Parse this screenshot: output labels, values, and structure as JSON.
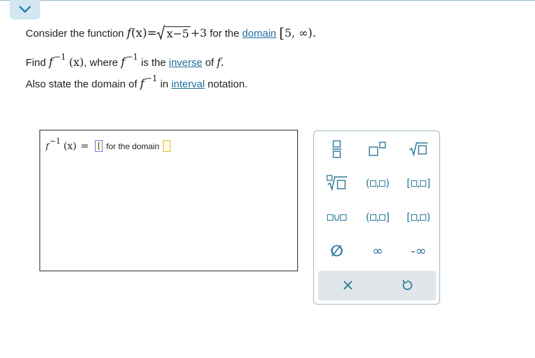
{
  "question": {
    "line1_prefix": "Consider the function",
    "line1_mid": "for the",
    "domain_link": "domain",
    "function_lhs_f": "f",
    "function_lhs_arg": "(x)",
    "equals": "=",
    "radicand": "x−5",
    "plus_term": "+3",
    "domain_interval": "5, ∞",
    "domain_left": "[",
    "domain_right": ").",
    "line2_find": "Find",
    "line2_where": ", where",
    "line2_is_the": "is the",
    "inverse_link": "inverse",
    "line2_of": "of",
    "line2_f_end": "f.",
    "inverse_arg": "(x)",
    "sup_minus1": "−1",
    "line3_prefix": "Also state the domain of",
    "line3_in": "in",
    "interval_link": "interval",
    "line3_suffix": "notation."
  },
  "answer": {
    "lhs_f": "f",
    "lhs_sup": "−1",
    "lhs_arg": "(x)",
    "equals": "=",
    "for_domain_label": "for the domain"
  },
  "palette": {
    "infinity": "∞",
    "neg_infinity": "-∞",
    "union_symbol": "∪",
    "empty_set": "∅",
    "clear": "×"
  },
  "colors": {
    "link": "#1f6f9e",
    "palette_accent": "#2a7898",
    "active_slot_border": "#6b7fd8",
    "slot_border": "#e0b832"
  }
}
